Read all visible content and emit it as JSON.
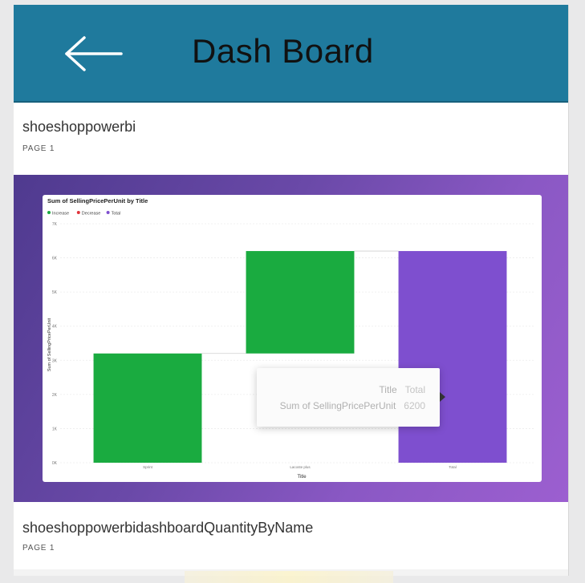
{
  "header": {
    "title": "Dash Board",
    "back_icon": "arrow-left-icon",
    "bg": "#1f7a9d"
  },
  "pages": [
    {
      "name": "shoeshoppowerbi",
      "sub": "PAGE 1"
    },
    {
      "name": "shoeshoppowerbidashboardQuantityByName",
      "sub": "PAGE 1"
    }
  ],
  "chart_data": {
    "type": "bar",
    "subtype": "waterfall",
    "title": "Sum of SellingPricePerUnit by Title",
    "legend": [
      "Increase",
      "Decrease",
      "Total"
    ],
    "legend_colors": [
      "#1aab40",
      "#e0343c",
      "#7e4fcf"
    ],
    "xlabel": "Title",
    "ylabel": "Sum of SellingPricePerUnit",
    "categories": [
      "Sprint",
      "Lacoste plus",
      "Total"
    ],
    "bars": [
      {
        "category": "Sprint",
        "start": 0,
        "end": 3200,
        "kind": "increase"
      },
      {
        "category": "Lacoste plus",
        "start": 3200,
        "end": 6200,
        "kind": "increase"
      },
      {
        "category": "Total",
        "start": 0,
        "end": 6200,
        "kind": "total"
      }
    ],
    "yticks": [
      "0K",
      "1K",
      "2K",
      "3K",
      "4K",
      "5K",
      "6K",
      "7K"
    ],
    "ylim": [
      0,
      7000
    ],
    "grid": true,
    "legend_position": "top-left"
  },
  "tooltip": {
    "title_key": "Title",
    "title_val": "Total",
    "value_key": "Sum of SellingPricePerUnit",
    "value_val": "6200"
  }
}
